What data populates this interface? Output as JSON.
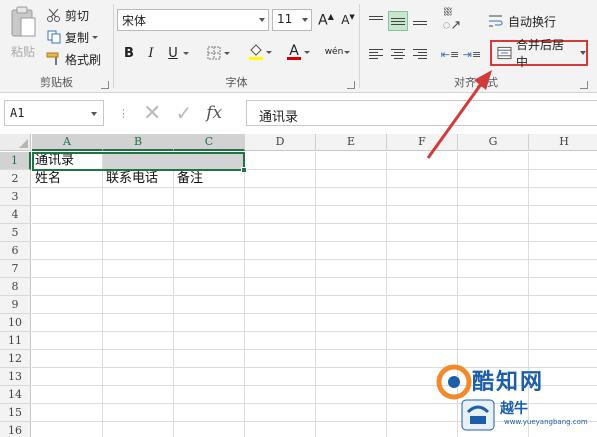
{
  "clipboard": {
    "paste": "粘贴",
    "cut": "剪切",
    "copy": "复制",
    "format_painter": "格式刷",
    "group": "剪贴板"
  },
  "font": {
    "name": "宋体",
    "size": "11",
    "bold": "B",
    "italic": "I",
    "underline": "U",
    "phonetic": "wén",
    "font_color_letter": "A",
    "group": "字体",
    "highlight_color": "#ffff00",
    "font_color": "#d40000"
  },
  "alignment": {
    "wrap_text": "自动换行",
    "merge_center": "合并后居中",
    "group": "对齐方式"
  },
  "formula_bar": {
    "name_box": "A1",
    "fx": "fx",
    "content": "通讯录"
  },
  "columns": [
    "A",
    "B",
    "C",
    "D",
    "E",
    "F",
    "G",
    "H"
  ],
  "rows": [
    "1",
    "2",
    "3",
    "4",
    "5",
    "6",
    "7",
    "8",
    "9",
    "10",
    "11",
    "12",
    "13",
    "14",
    "15",
    "16"
  ],
  "cells": {
    "A1": "通讯录",
    "A2": "姓名",
    "B2": "联系电话",
    "C2": "备注"
  },
  "watermark": {
    "title": "酷知网",
    "subtitle": "越牛",
    "url": "www.yueyangbang.com"
  },
  "colors": {
    "accent": "#217346",
    "annotation": "#d33a3a"
  }
}
